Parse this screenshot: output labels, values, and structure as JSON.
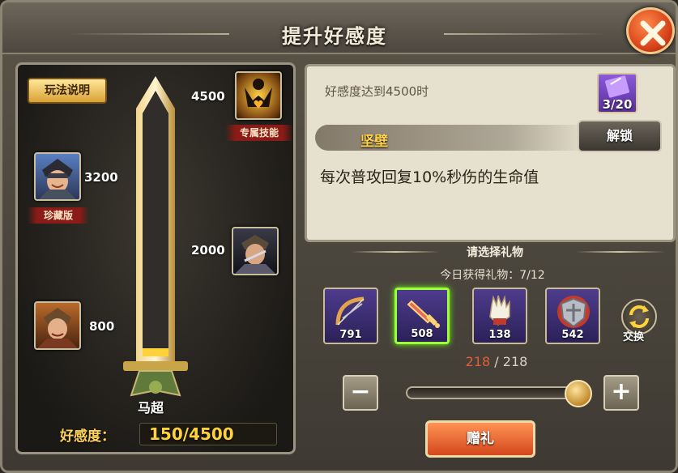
{
  "title": "提升好感度",
  "close_icon": "close-x-icon",
  "left": {
    "rules_label": "玩法说明",
    "hero_name": "马超",
    "favor_label": "好感度：",
    "favor_value": "150/4500",
    "favor_progress_fraction": 0.0333,
    "milestones": [
      {
        "value": "4500",
        "tag": "专属技能",
        "icon": "exclusive-skill-icon"
      },
      {
        "value": "3200",
        "tag": "珍藏版",
        "icon": "hero-portrait-collector-icon"
      },
      {
        "value": "2000",
        "tag": "",
        "icon": "hero-portrait-icon"
      },
      {
        "value": "800",
        "tag": "",
        "icon": "hero-portrait-icon"
      }
    ]
  },
  "info": {
    "condition": "好感度达到4500时",
    "book_count": "3/20",
    "book_icon": "book-icon",
    "skill_name": "坚壁",
    "unlock_label": "解锁",
    "skill_desc": "每次普攻回复10%秒伤的生命值"
  },
  "gifts": {
    "title": "请选择礼物",
    "today": "今日获得礼物：7/12",
    "swap_label": "交换",
    "items": [
      {
        "icon": "bow-icon",
        "count": "791",
        "selected": false
      },
      {
        "icon": "sword-icon",
        "count": "508",
        "selected": true
      },
      {
        "icon": "gauntlet-icon",
        "count": "138",
        "selected": false
      },
      {
        "icon": "shield-icon",
        "count": "542",
        "selected": false
      }
    ],
    "qty_current": "218",
    "qty_sep": " / ",
    "qty_max": "218",
    "slider_fraction": 1.0,
    "minus_label": "−",
    "plus_label": "+",
    "give_label": "赠礼"
  },
  "colors": {
    "accent_gold": "#ffd23c",
    "selected_border": "#9cff3a",
    "button_orange": "#d4471c"
  }
}
